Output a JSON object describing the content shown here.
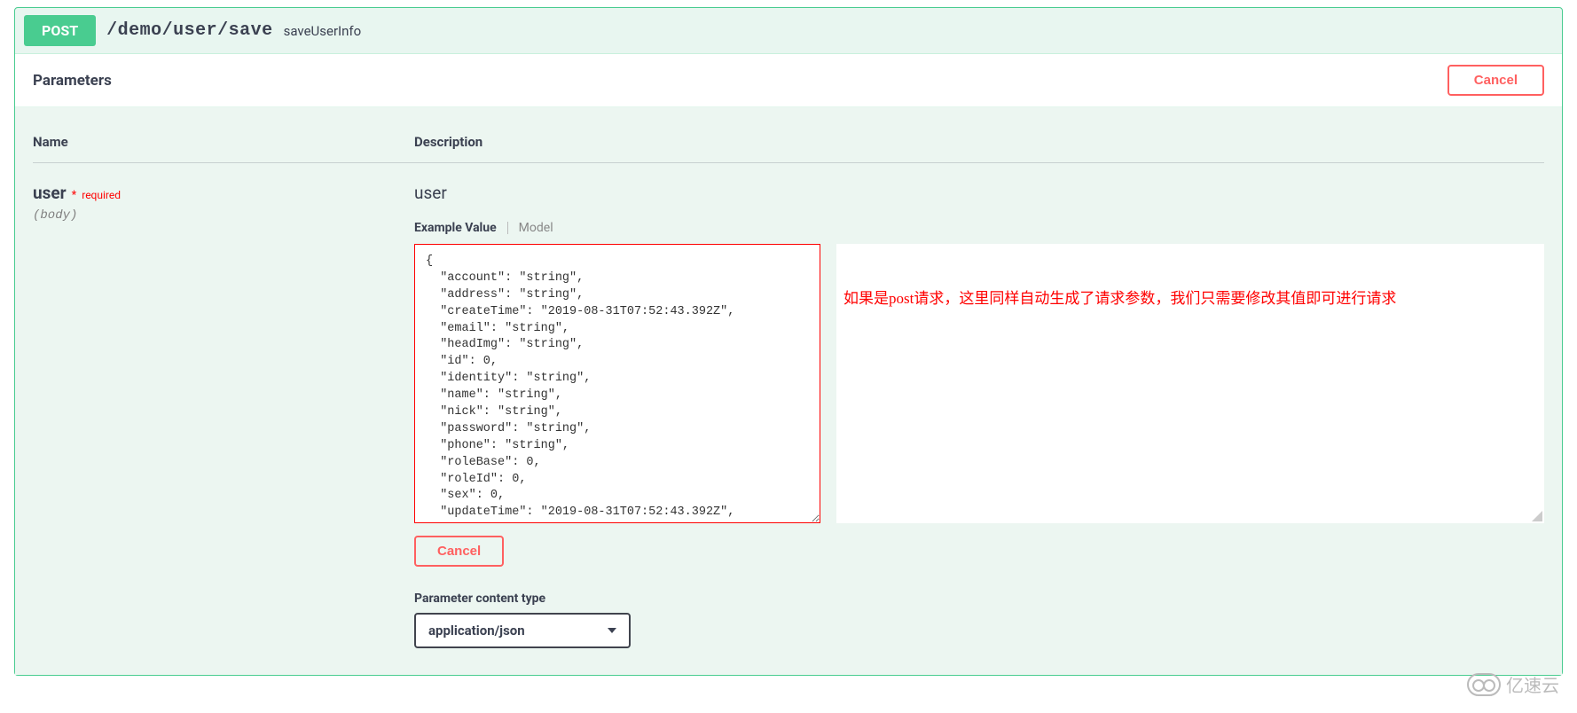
{
  "method": "POST",
  "path": "/demo/user/save",
  "operationId": "saveUserInfo",
  "parametersTitle": "Parameters",
  "cancelLabel": "Cancel",
  "columns": {
    "name": "Name",
    "description": "Description"
  },
  "param": {
    "name": "user",
    "requiredStar": "*",
    "requiredText": "required",
    "in": "(body)",
    "description": "user"
  },
  "tabs": {
    "exampleValue": "Example Value",
    "model": "Model"
  },
  "exampleBody": "{\n  \"account\": \"string\",\n  \"address\": \"string\",\n  \"createTime\": \"2019-08-31T07:52:43.392Z\",\n  \"email\": \"string\",\n  \"headImg\": \"string\",\n  \"id\": 0,\n  \"identity\": \"string\",\n  \"name\": \"string\",\n  \"nick\": \"string\",\n  \"password\": \"string\",\n  \"phone\": \"string\",\n  \"roleBase\": 0,\n  \"roleId\": 0,\n  \"sex\": 0,\n  \"updateTime\": \"2019-08-31T07:52:43.392Z\",\n  \"userId\": \"string\"\n}",
  "annotation": "如果是post请求，这里同样自动生成了请求参数，我们只需要修改其值即可进行请求",
  "cancelSmall": "Cancel",
  "contentTypeLabel": "Parameter content type",
  "contentTypeValue": "application/json",
  "watermark": "亿速云"
}
